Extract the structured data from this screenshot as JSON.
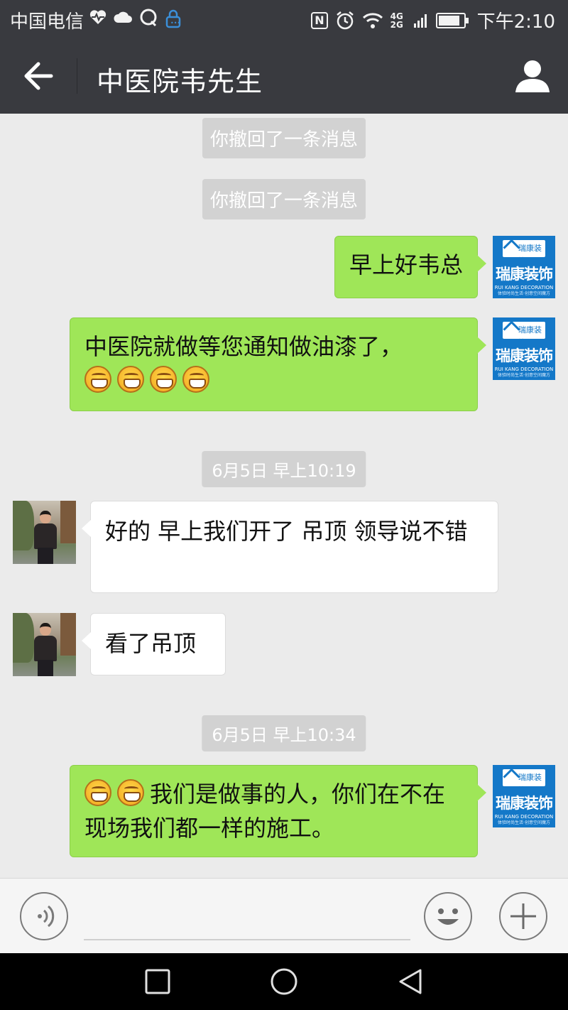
{
  "status_bar": {
    "carrier": "中国电信",
    "nfc": "N",
    "network": "4G 2G",
    "time": "下午2:10",
    "battery_level": 0.85,
    "icons": [
      "heart-rate-icon",
      "cloud-icon",
      "qq-icon",
      "lock-icon",
      "nfc-icon",
      "alarm-icon",
      "wifi-icon",
      "signal-icon",
      "battery-icon"
    ]
  },
  "header": {
    "title": "中医院韦先生",
    "back_icon": "back-arrow-icon",
    "contact_icon": "person-icon"
  },
  "messages": {
    "recalled_1": "你撤回了一条消息",
    "recalled_2": "你撤回了一条消息",
    "out_1": "早上好韦总",
    "out_2_text": "中医院就做等您通知做油漆了，",
    "time_1": "6月5日 早上10:19",
    "in_1": "好的 早上我们开了 吊顶 领导说不错",
    "in_2": "看了吊顶",
    "time_2": "6月5日 早上10:34",
    "out_3_text": "我们是做事的人，你们在不在现场我们都一样的施工。"
  },
  "self_avatar": {
    "brand": "瑞康装饰",
    "small": "瑞康装饰",
    "en": "RUI KANG DECORATION",
    "slogan": "体验时尚生活·创意空间魔方"
  },
  "input_bar": {
    "voice_icon": "voice-icon",
    "emoji_icon": "emoji-icon",
    "plus_icon": "plus-icon"
  },
  "colors": {
    "bar": "#393a3f",
    "background": "#ebebeb",
    "outgoing_bubble": "#9fe658",
    "incoming_bubble": "#ffffff",
    "system_tag": "#d2d2d2",
    "logo_blue": "#1478c8"
  }
}
